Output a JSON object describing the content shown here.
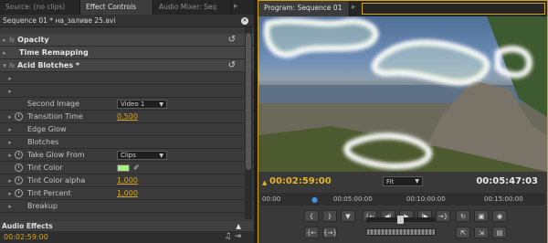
{
  "left_panel": {
    "tabs": [
      "Source: (no clips)",
      "Effect Controls",
      "Audio Mixer: Seq"
    ],
    "active_tab": 1,
    "sequence_title": "Sequence 01 * на_заливе 25.avi",
    "effects": {
      "opacity": "Opacity",
      "time_remapping": "Time Remapping",
      "acid_blotches": "Acid Blotches *"
    },
    "params": {
      "second_image_label": "Second Image",
      "second_image_value": "Video 1",
      "transition_time_label": "Transition Time",
      "transition_time_value": "0,500",
      "edge_glow_label": "Edge Glow",
      "blotches_label": "Blotches",
      "take_glow_from_label": "Take Glow From",
      "take_glow_from_value": "Clips",
      "tint_color_label": "Tint Color",
      "tint_color_hex": "#a8f080",
      "tint_color_alpha_label": "Tint Color alpha",
      "tint_color_alpha_value": "1,000",
      "tint_percent_label": "Tint Percent",
      "tint_percent_value": "1,000",
      "breakup_label": "Breakup"
    },
    "audio_effects": "Audio Effects",
    "timecode": "00:02:59:00"
  },
  "right_panel": {
    "tab": "Program: Sequence 01",
    "timecode_current": "00:02:59:00",
    "timecode_duration": "00:05:47:03",
    "fit": "Fit",
    "ruler": [
      "00:00",
      "00:05:00:00",
      "00:10:00:00",
      "00:15:00:00"
    ]
  },
  "colors": {
    "accent_timecode": "#e4b429",
    "active_border": "#d4a21a"
  }
}
